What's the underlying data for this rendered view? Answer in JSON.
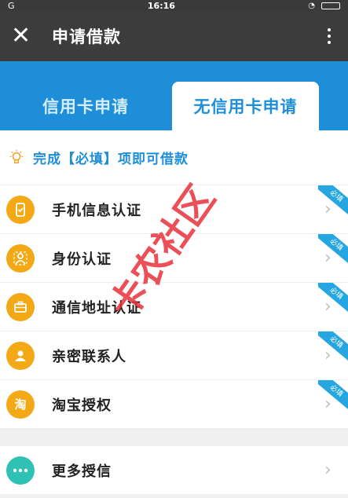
{
  "statusbar": {
    "signal": "G",
    "time": "16:16"
  },
  "titlebar": {
    "close": "✕",
    "title": "申请借款"
  },
  "tabs": [
    {
      "label": "信用卡申请",
      "active": false
    },
    {
      "label": "无信用卡申请",
      "active": true
    }
  ],
  "notice": {
    "text": "完成【必填】项即可借款"
  },
  "items": [
    {
      "label": "手机信息认证",
      "badge": "必填",
      "icon": "phone-icon"
    },
    {
      "label": "身份认证",
      "badge": "必填",
      "icon": "id-card-icon"
    },
    {
      "label": "通信地址认证",
      "badge": "必填",
      "icon": "briefcase-icon"
    },
    {
      "label": "亲密联系人",
      "badge": "必填",
      "icon": "contact-icon"
    },
    {
      "label": "淘宝授权",
      "badge": "必填",
      "icon": "taobao-icon",
      "icon_text": "淘"
    }
  ],
  "more": {
    "label": "更多授信",
    "icon": "more-dots-icon"
  },
  "colors": {
    "accent": "#1e8ed8",
    "icon_bg": "#f3a816",
    "badge": "#26a6e0",
    "more_icon": "#2fc2b4"
  },
  "watermark": "卡农社区"
}
